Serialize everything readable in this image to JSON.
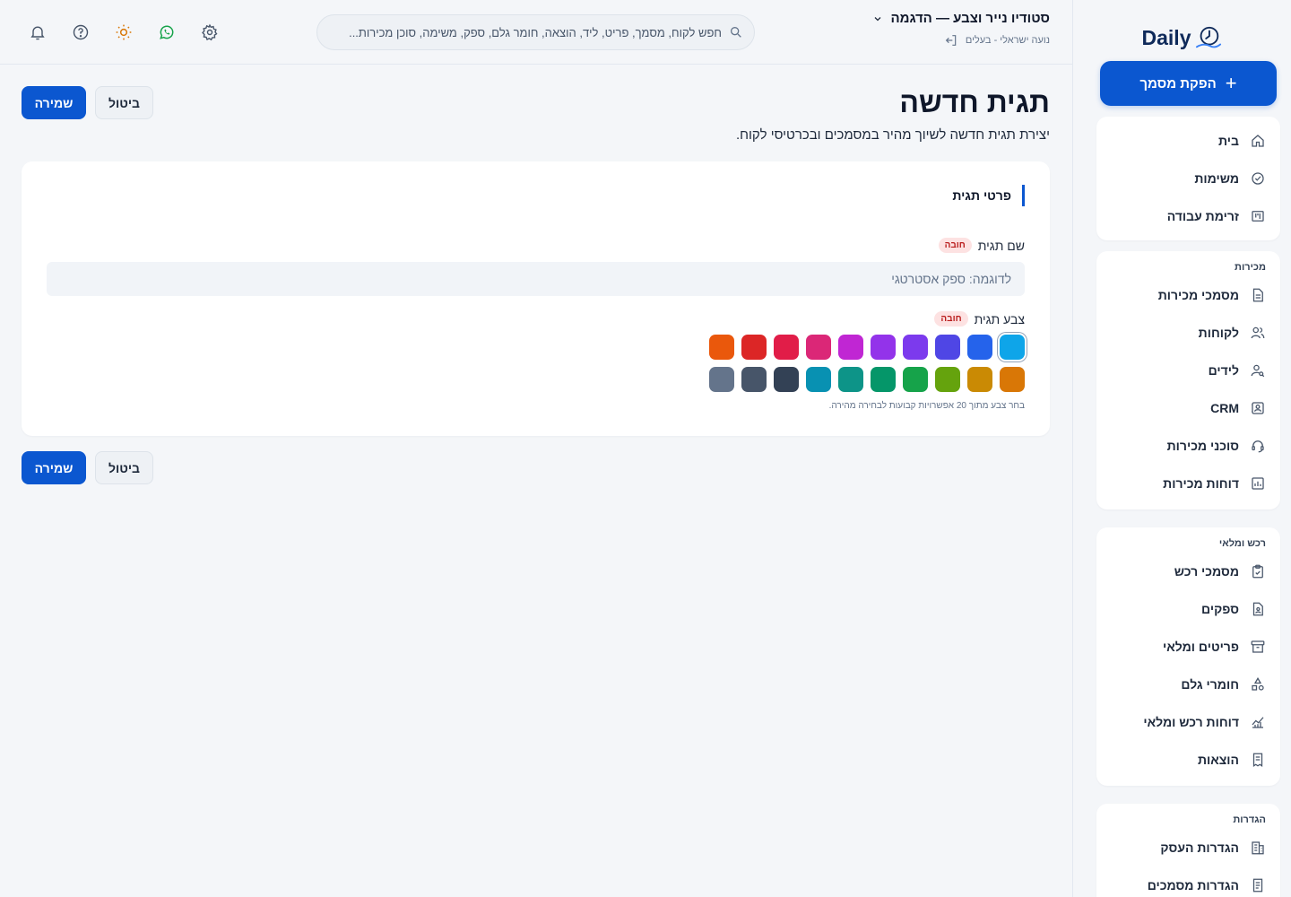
{
  "sidebar": {
    "logo_text": "Daily",
    "new_document": "הפקת מסמך",
    "group_main": [
      {
        "label": "בית",
        "icon": "home-icon"
      },
      {
        "label": "משימות",
        "icon": "check-circle-icon"
      },
      {
        "label": "זרימת עבודה",
        "icon": "kanban-icon"
      }
    ],
    "group_sales": {
      "title": "מכירות",
      "items": [
        {
          "label": "מסמכי מכירות",
          "icon": "document-icon"
        },
        {
          "label": "לקוחות",
          "icon": "users-icon"
        },
        {
          "label": "לידים",
          "icon": "user-search-icon"
        },
        {
          "label": "CRM",
          "icon": "contact-card-icon"
        },
        {
          "label": "סוכני מכירות",
          "icon": "headset-icon"
        },
        {
          "label": "דוחות מכירות",
          "icon": "bar-report-icon"
        }
      ]
    },
    "group_purchasing": {
      "title": "רכש ומלאי",
      "items": [
        {
          "label": "מסמכי רכש",
          "icon": "clipboard-check-icon"
        },
        {
          "label": "ספקים",
          "icon": "supplier-doc-icon"
        },
        {
          "label": "פריטים ומלאי",
          "icon": "archive-box-icon"
        },
        {
          "label": "חומרי גלם",
          "icon": "shapes-icon"
        },
        {
          "label": "דוחות רכש ומלאי",
          "icon": "line-chart-icon"
        },
        {
          "label": "הוצאות",
          "icon": "receipt-icon"
        }
      ]
    },
    "group_settings": {
      "title": "הגדרות",
      "items": [
        {
          "label": "הגדרות העסק",
          "icon": "building-icon"
        },
        {
          "label": "הגדרות מסמכים",
          "icon": "doc-settings-icon"
        }
      ]
    }
  },
  "header": {
    "business_name": "סטודיו נייר וצבע — הדגמה",
    "user_line": "נועה ישראלי - בעלים",
    "search_placeholder": "חפש לקוח, מסמך, פריט, ליד, הוצאה, חומר גלם, ספק, משימה, סוכן מכירות..."
  },
  "page": {
    "title": "תגית חדשה",
    "description": "יצירת תגית חדשה לשיוך מהיר במסמכים ובכרטיסי לקוח.",
    "save": "שמירה",
    "cancel": "ביטול"
  },
  "form": {
    "section_title": "פרטי תגית",
    "name_label": "שם תגית",
    "required": "חובה",
    "name_value": "",
    "name_placeholder": "לדוגמה: ספק אסטרטגי",
    "color_label": "צבע תגית",
    "color_hint": "בחר צבע מתוך 20 אפשרויות קבועות לבחירה מהירה.",
    "selected_color": "#0ea5e9",
    "colors": [
      "#0ea5e9",
      "#2563eb",
      "#4f46e5",
      "#7c3aed",
      "#9333ea",
      "#c026d3",
      "#db2777",
      "#e11d48",
      "#dc2626",
      "#ea580c",
      "#d97706",
      "#ca8a04",
      "#65a30d",
      "#16a34a",
      "#059669",
      "#0d9488",
      "#0891b2",
      "#334155",
      "#475569",
      "#64748b"
    ]
  }
}
